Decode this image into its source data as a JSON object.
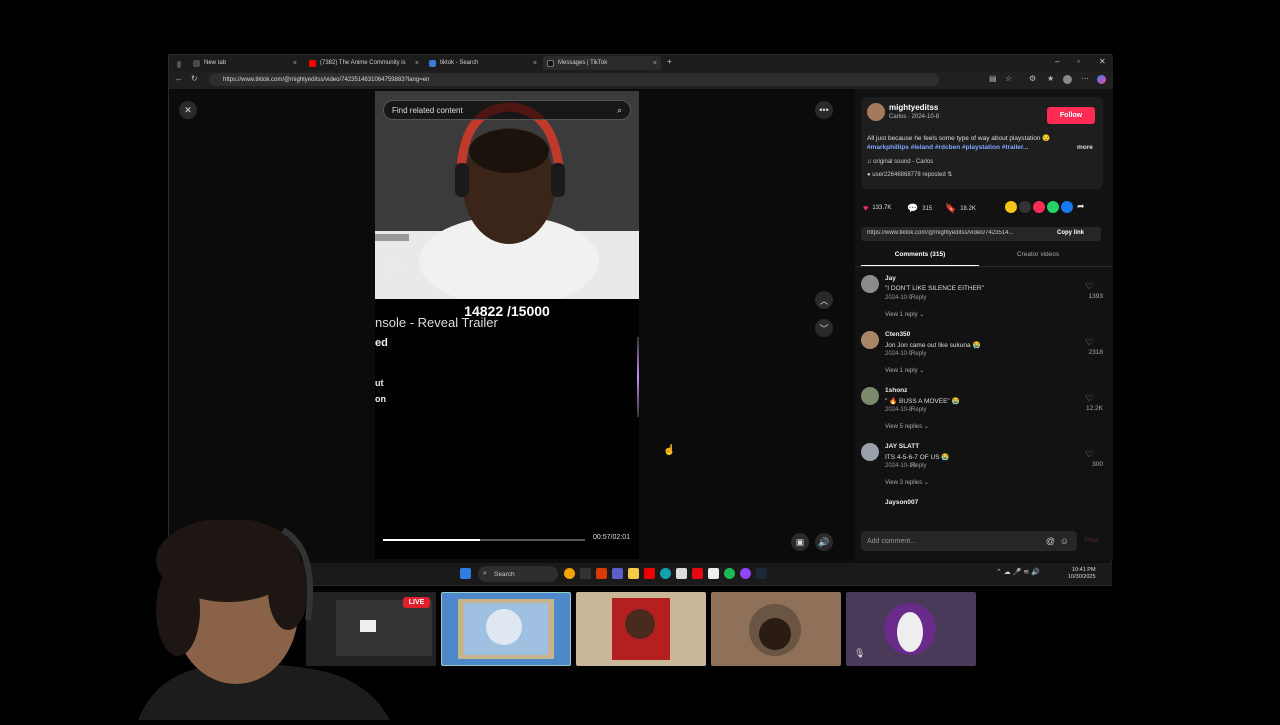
{
  "browser": {
    "tabs": [
      {
        "title": "New tab",
        "favicon_color": "#4a4a4a"
      },
      {
        "title": "(7382) The Anime Community is",
        "favicon_color": "#ff0000"
      },
      {
        "title": "tiktok - Search",
        "favicon_color": "#3a7bd5"
      },
      {
        "title": "Messages | TikTok",
        "favicon_color": "#111111"
      }
    ],
    "new_tab_symbol": "+",
    "close_symbol": "×",
    "url": "https://www.tiktok.com/@mightyeditss/video/7423514631064759883?lang=en"
  },
  "video": {
    "search_placeholder": "Find related content",
    "counter": "14822 /15000",
    "caption_line1": "nsole - Reveal Trailer",
    "caption_line2": "ed",
    "caption_line3a": "ut",
    "caption_line3b": "on",
    "time": "00:57/02:01",
    "progress_fraction": 0.48
  },
  "post": {
    "username": "mightyeditss",
    "subline": "Carlos · 2024-10-8",
    "follow_label": "Follow",
    "description": "All just because he feels some type of way about playstation 😒",
    "tags": "#markphillips #leland #rdcben #playstation #trailer...",
    "more_label": "more",
    "sound": "original sound - Carlos",
    "repost": "user22646868778 reposted",
    "likes": "133.7K",
    "comments": "315",
    "saves": "18.2K",
    "link": "https://www.tiktok.com/@mightyeditss/video/7423514...",
    "copy_link_label": "Copy link",
    "colors": {
      "accent": "#fe2c55"
    }
  },
  "tabs": {
    "comments": "Comments (315)",
    "creator_videos": "Creator videos"
  },
  "comments": [
    {
      "name": "Jay",
      "text": "\"I DON'T LIKE SILENCE EITHER\"",
      "date": "2024-10-9",
      "reply": "Reply",
      "views": "View 1 reply ⌄",
      "likes": "1393",
      "avatar": "#8a8a8a"
    },
    {
      "name": "Cten350",
      "text": "Jon Jon came out like sukuna 😭",
      "date": "2024-10-9",
      "reply": "Reply",
      "views": "View 1 reply ⌄",
      "likes": "2318",
      "avatar": "#a98568"
    },
    {
      "name": "1shonz",
      "text": "\" 🔥 BUSS A MOVEE\" 😭",
      "date": "2024-10-8",
      "reply": "Reply",
      "views": "View 5 replies ⌄",
      "likes": "12.2K",
      "avatar": "#7a8a6a"
    },
    {
      "name": "JAY SLATT",
      "text": "ITS 4-5-6-7 OF US 😭",
      "date": "2024-10-10",
      "reply": "Reply",
      "views": "View 3 replies ⌄",
      "likes": "300",
      "avatar": "#9aa0aa"
    },
    {
      "name": "Jayson007",
      "text": "",
      "date": "",
      "reply": "",
      "views": "",
      "likes": "",
      "avatar": "#555555"
    }
  ],
  "comment_input": {
    "placeholder": "Add comment...",
    "post_label": "Post"
  },
  "taskbar": {
    "search_label": "Search",
    "time": "10:41 PM",
    "date": "10/30/2025"
  },
  "stream": {
    "live_label": "LIVE"
  }
}
